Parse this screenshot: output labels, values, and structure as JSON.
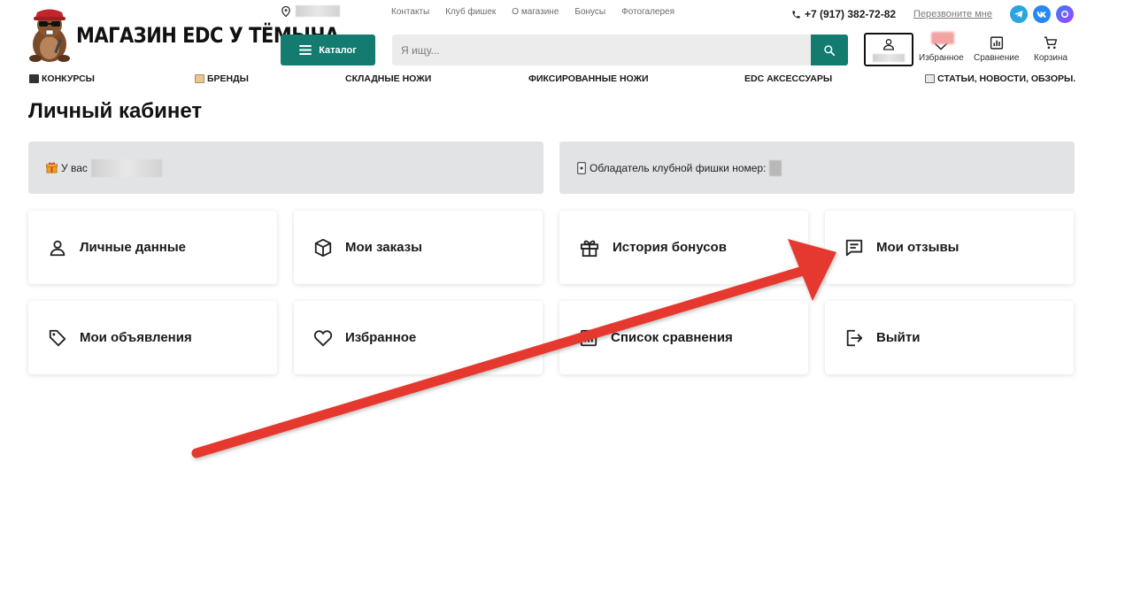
{
  "header": {
    "logo_text": "МАГАЗИН EDC У ТЁМЫЧА",
    "top_links": [
      "Контакты",
      "Клуб фишек",
      "О магазине",
      "Бонусы",
      "Фотогалерея"
    ],
    "phone": "+7 (917) 382-72-82",
    "callback": "Перезвоните мне",
    "socials": [
      "telegram-icon",
      "vk-icon",
      "max-icon"
    ],
    "catalog_label": "Каталог",
    "search_placeholder": "Я ищу...",
    "favorites_label": "Избранное",
    "compare_label": "Сравнение",
    "cart_label": "Корзина"
  },
  "nav": {
    "items": [
      "КОНКУРСЫ",
      "БРЕНДЫ",
      "СКЛАДНЫЕ НОЖИ",
      "ФИКСИРОВАННЫЕ НОЖИ",
      "EDC АКСЕССУАРЫ",
      "СТАТЬИ, НОВОСТИ, ОБЗОРЫ."
    ]
  },
  "page": {
    "title": "Личный кабинет",
    "bonus_text": "У вас",
    "club_text": "Обладатель клубной фишки номер:"
  },
  "cards": [
    {
      "label": "Личные данные",
      "icon": "user-icon"
    },
    {
      "label": "Мои заказы",
      "icon": "box-icon"
    },
    {
      "label": "История бонусов",
      "icon": "gift-icon"
    },
    {
      "label": "Мои отзывы",
      "icon": "message-icon"
    },
    {
      "label": "Мои объявления",
      "icon": "tag-icon"
    },
    {
      "label": "Избранное",
      "icon": "heart-icon"
    },
    {
      "label": "Список сравнения",
      "icon": "compare-icon"
    },
    {
      "label": "Выйти",
      "icon": "logout-icon"
    }
  ],
  "colors": {
    "accent": "#137b6f",
    "panel": "#e2e3e5",
    "arrow": "#e5372e"
  }
}
